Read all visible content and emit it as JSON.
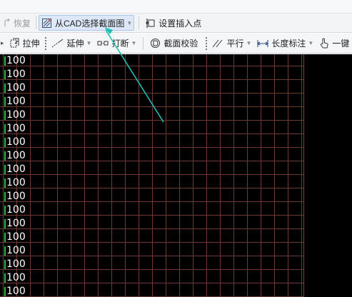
{
  "toolbar_top": {
    "restore_label": "恢复",
    "select_section_label": "从CAD选择截面图",
    "set_insert_point_label": "设置插入点"
  },
  "toolbar_bottom": {
    "stretch_label": "拉伸",
    "extend_label": "延伸",
    "break_label": "打断",
    "section_check_label": "截面校验",
    "parallel_label": "平行",
    "length_dim_label": "长度标注",
    "one_key_label": "一键"
  },
  "canvas": {
    "row_labels": [
      "100",
      "100",
      "100",
      "100",
      "100",
      "100",
      "100",
      "100",
      "100",
      "100",
      "100",
      "100",
      "100",
      "100",
      "100",
      "100",
      "100",
      "100"
    ],
    "colors": {
      "background": "#000000",
      "grid_line": "#6b3a30",
      "label_text": "#ffffff",
      "label_marker": "#2db34a",
      "annotation_arrow": "#1fbfb8"
    }
  }
}
